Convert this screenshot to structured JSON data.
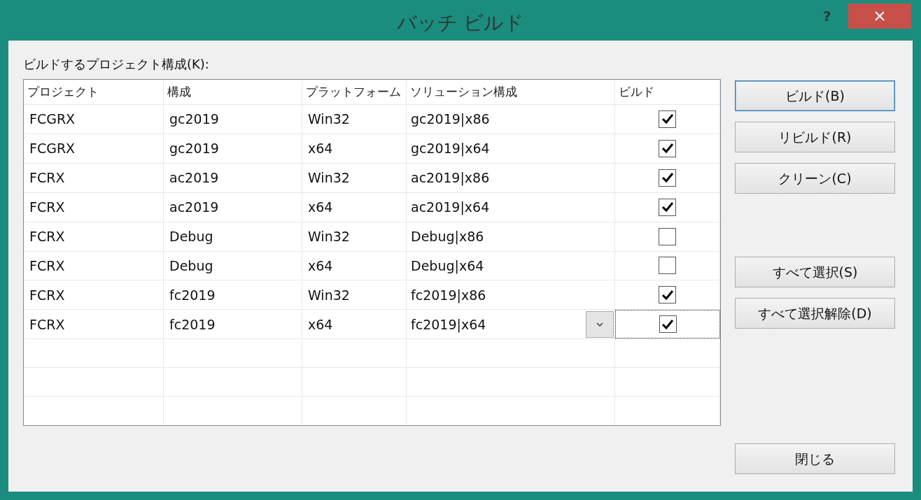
{
  "window": {
    "title": "バッチ ビルド",
    "help": "?"
  },
  "list_label": "ビルドするプロジェクト構成(K):",
  "table": {
    "columns": [
      "プロジェクト",
      "構成",
      "プラットフォーム",
      "ソリューション構成",
      "ビルド"
    ],
    "rows": [
      {
        "project": "FCGRX",
        "config": "gc2019",
        "platform": "Win32",
        "solution": "gc2019|x86",
        "checked": true,
        "current": false
      },
      {
        "project": "FCGRX",
        "config": "gc2019",
        "platform": "x64",
        "solution": "gc2019|x64",
        "checked": true,
        "current": false
      },
      {
        "project": "FCRX",
        "config": "ac2019",
        "platform": "Win32",
        "solution": "ac2019|x86",
        "checked": true,
        "current": false
      },
      {
        "project": "FCRX",
        "config": "ac2019",
        "platform": "x64",
        "solution": "ac2019|x64",
        "checked": true,
        "current": false
      },
      {
        "project": "FCRX",
        "config": "Debug",
        "platform": "Win32",
        "solution": "Debug|x86",
        "checked": false,
        "current": false
      },
      {
        "project": "FCRX",
        "config": "Debug",
        "platform": "x64",
        "solution": "Debug|x64",
        "checked": false,
        "current": false
      },
      {
        "project": "FCRX",
        "config": "fc2019",
        "platform": "Win32",
        "solution": "fc2019|x86",
        "checked": true,
        "current": false
      },
      {
        "project": "FCRX",
        "config": "fc2019",
        "platform": "x64",
        "solution": "fc2019|x64",
        "checked": true,
        "current": true
      }
    ]
  },
  "buttons": {
    "build": [
      {
        "label": "ビルド(B)",
        "default": true
      },
      {
        "label": "リビルド(R)",
        "default": false
      },
      {
        "label": "クリーン(C)",
        "default": false
      }
    ],
    "selection": [
      {
        "label": "すべて選択(S)",
        "default": false
      },
      {
        "label": "すべて選択解除(D)",
        "default": false
      }
    ],
    "close": {
      "label": "閉じる",
      "default": false
    }
  }
}
